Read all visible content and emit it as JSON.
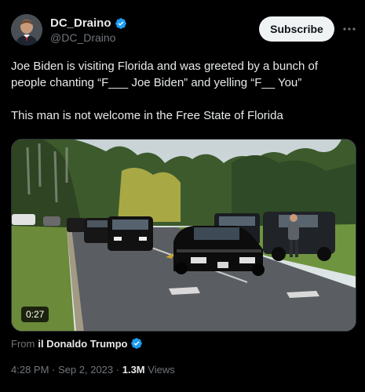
{
  "author": {
    "display_name": "DC_Draino",
    "handle": "@DC_Draino",
    "verified_icon": "verified-badge-icon"
  },
  "subscribe_label": "Subscribe",
  "more_icon": "more-options-icon",
  "tweet": {
    "line1": "Joe Biden is visiting Florida and was greeted by a bunch of people chanting “F___ Joe Biden” and yelling “F__ You”",
    "line2": "This man is not welcome in the Free State of Florida"
  },
  "media": {
    "duration": "0:27"
  },
  "attribution": {
    "prefix": "From",
    "name": "il Donaldo Trumpo"
  },
  "meta": {
    "time": "4:28 PM",
    "separator1": "·",
    "date": "Sep 2, 2023",
    "separator2": "·",
    "views_count": "1.3M",
    "views_label": "Views"
  },
  "colors": {
    "background": "#000000",
    "text": "#e7e9ea",
    "muted": "#71767b",
    "verified": "#1d9bf0"
  }
}
